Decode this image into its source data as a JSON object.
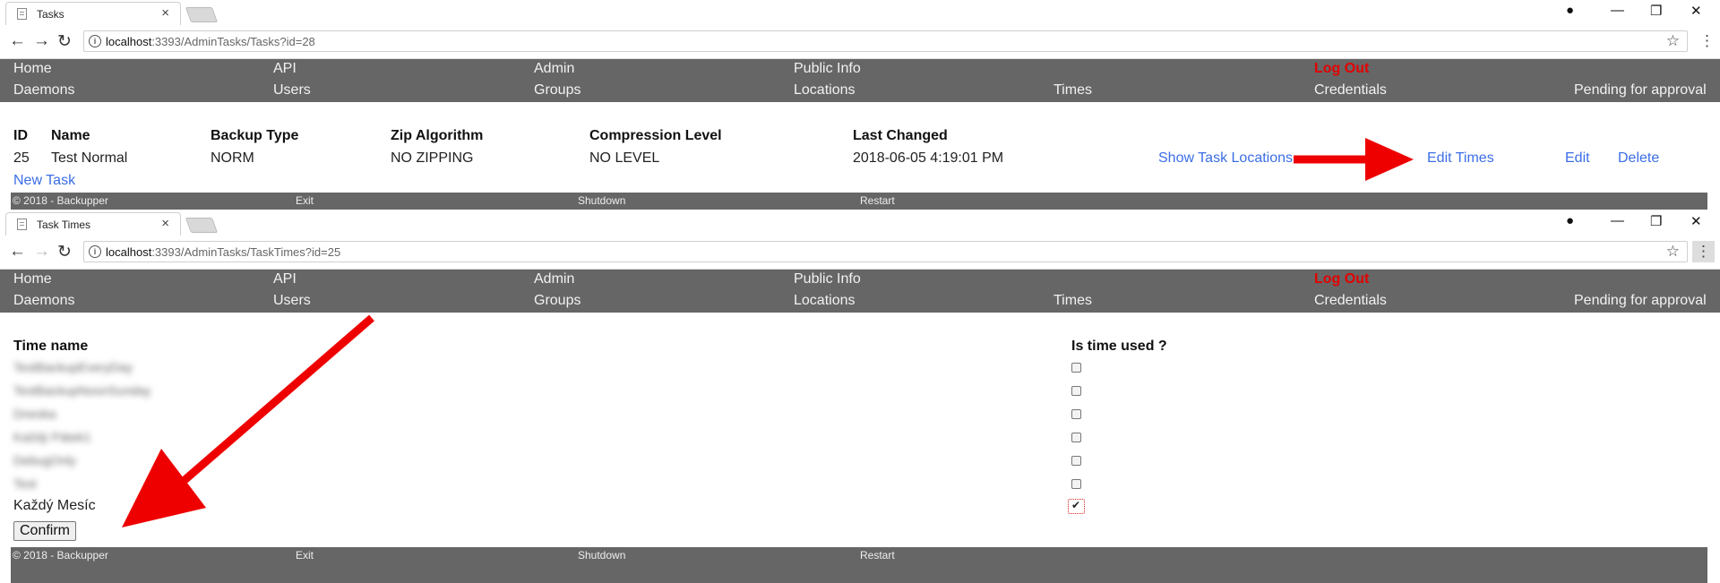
{
  "browser": {
    "tab1_title": "Tasks",
    "tab2_title": "Task Times",
    "close_glyph": "×",
    "url1_host": "localhost",
    "url1_path": ":3393/AdminTasks/Tasks?id=28",
    "url2_host": "localhost",
    "url2_path": ":3393/AdminTasks/TaskTimes?id=25",
    "icons": [
      "back-icon",
      "forward-icon",
      "reload-icon",
      "info-icon",
      "star-icon",
      "menu-icon",
      "profile-icon",
      "minimize-icon",
      "restore-icon",
      "close-icon"
    ]
  },
  "nav": {
    "home": "Home",
    "api": "API",
    "admin": "Admin",
    "public_info": "Public Info",
    "logout": "Log Out",
    "daemons": "Daemons",
    "users": "Users",
    "groups": "Groups",
    "locations": "Locations",
    "times": "Times",
    "credentials": "Credentials",
    "pending": "Pending for approval"
  },
  "tasks_table": {
    "headers": [
      "ID",
      "Name",
      "Backup Type",
      "Zip Algorithm",
      "Compression Level",
      "Last Changed"
    ],
    "row": {
      "id": "25",
      "name": "Test Normal",
      "backup_type": "NORM",
      "zip": "NO ZIPPING",
      "level": "NO LEVEL",
      "last_changed": "2018-06-05 4:19:01 PM"
    },
    "actions": {
      "show_locations": "Show Task Locations",
      "edit_times": "Edit Times",
      "edit": "Edit",
      "delete": "Delete"
    },
    "new_task": "New Task"
  },
  "footer": {
    "copyright": "© 2018 - Backupper",
    "exit": "Exit",
    "shutdown": "Shutdown",
    "restart": "Restart"
  },
  "times_table": {
    "header_name": "Time name",
    "header_used": "Is time used ?",
    "rows": [
      {
        "name": "TestBackupEveryDay",
        "checked": false
      },
      {
        "name": "TestBackupNoonSunday",
        "checked": false
      },
      {
        "name": "Dneska",
        "checked": false
      },
      {
        "name": "Každý Pátek1",
        "checked": false
      },
      {
        "name": "DebugOnly",
        "checked": false
      },
      {
        "name": "Test",
        "checked": false
      },
      {
        "name": "Každý Mesíc",
        "checked": true
      }
    ],
    "confirm": "Confirm"
  },
  "colors": {
    "nav_bg": "#666666",
    "logout": "#e40000",
    "link": "#3b6ee6",
    "arrow": "#ee0000"
  }
}
